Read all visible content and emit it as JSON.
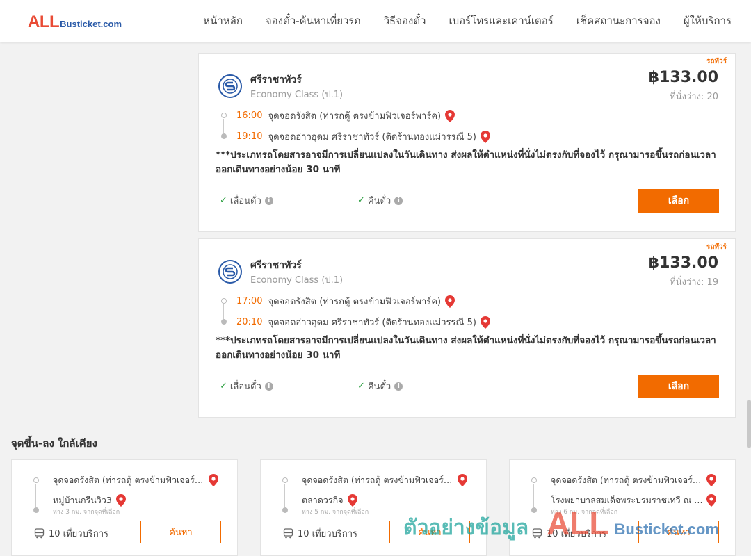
{
  "header": {
    "logo_all": "ALL",
    "logo_rest": "Busticket.com",
    "nav": [
      "หน้าหลัก",
      "จองตั๋ว-ค้นหาเที่ยวรถ",
      "วิธีจองตั๋ว",
      "เบอร์โทรและเคาน์เตอร์",
      "เช็คสถานะการจอง",
      "ผู้ให้บริการ"
    ]
  },
  "trips": [
    {
      "ribbon": "รถทัวร์",
      "operator": "ศรีราชาทัวร์",
      "class": "Economy Class (ป.1)",
      "price": "฿133.00",
      "seats": "ที่นั่งว่าง: 20",
      "depart_time": "16:00",
      "depart_stop": "จุดจอดรังสิต (ท่ารถตู้ ตรงข้ามฟิวเจอร์พาร์ค)",
      "arrive_time": "19:10",
      "arrive_stop": "จุดจอดอ่าวอุดม ศรีราชาทัวร์ (ติดร้านทองแม่วรรณี 5)",
      "note": "***ประเภทรถโดยสารอาจมีการเปลี่ยนแปลงในวันเดินทาง ส่งผลให้ตำแหน่งที่นั่งไม่ตรงกับที่จองไว้ กรุณามารอขึ้นรถก่อนเวลาออกเดินทางอย่างน้อย 30 นาที",
      "feature_1": "เลื่อนตั๋ว",
      "feature_2": "คืนตั๋ว",
      "button": "เลือก"
    },
    {
      "ribbon": "รถทัวร์",
      "operator": "ศรีราชาทัวร์",
      "class": "Economy Class (ป.1)",
      "price": "฿133.00",
      "seats": "ที่นั่งว่าง: 19",
      "depart_time": "17:00",
      "depart_stop": "จุดจอดรังสิต (ท่ารถตู้ ตรงข้ามฟิวเจอร์พาร์ค)",
      "arrive_time": "20:10",
      "arrive_stop": "จุดจอดอ่าวอุดม ศรีราชาทัวร์ (ติดร้านทองแม่วรรณี 5)",
      "note": "***ประเภทรถโดยสารอาจมีการเปลี่ยนแปลงในวันเดินทาง ส่งผลให้ตำแหน่งที่นั่งไม่ตรงกับที่จองไว้ กรุณามารอขึ้นรถก่อนเวลาออกเดินทางอย่างน้อย 30 นาที",
      "feature_1": "เลื่อนตั๋ว",
      "feature_2": "คืนตั๋ว",
      "button": "เลือก"
    }
  ],
  "nearby": {
    "title": "จุดขึ้น-ลง ใกล้เคียง",
    "cards": [
      {
        "from": "จุดจอดรังสิต (ท่ารถตู้ ตรงข้ามฟิวเจอร์พาร์ค)",
        "to": "หมู่บ้านกรีนวิว3",
        "distance": "ห่าง 3 กม. จากจุดที่เลือก",
        "trips": "10 เที่ยวบริการ",
        "button": "ค้นหา"
      },
      {
        "from": "จุดจอดรังสิต (ท่ารถตู้ ตรงข้ามฟิวเจอร์พาร์ค)",
        "to": "ตลาดวรกิจ",
        "distance": "ห่าง 5 กม. จากจุดที่เลือก",
        "trips": "10 เที่ยวบริการ",
        "button": "ค้นหา"
      },
      {
        "from": "จุดจอดรังสิต (ท่ารถตู้ ตรงข้ามฟิวเจอร์พาร์ค)",
        "to": "โรงพยาบาลสมเด็จพระบรมราชเทวี ณ ศรีราชา",
        "distance": "ห่าง 6 กม. จากจุดที่เลือก",
        "trips": "10 เที่ยวบริการ",
        "button": "ค้นหา"
      }
    ]
  },
  "watermark": {
    "text": "ตัวอย่างข้อมูล",
    "brand_all": "ALL",
    "brand_rest": "Busticket.com"
  },
  "colors": {
    "accent": "#f26b00",
    "logo_red": "#e94b35",
    "logo_blue": "#2a5aa8",
    "pin_red": "#e53935",
    "check_green": "#2ea043"
  },
  "icons": {
    "pin": "map-pin-icon",
    "check": "check-icon",
    "info": "info-icon",
    "bus": "bus-icon",
    "operator_logo": "operator-logo"
  }
}
